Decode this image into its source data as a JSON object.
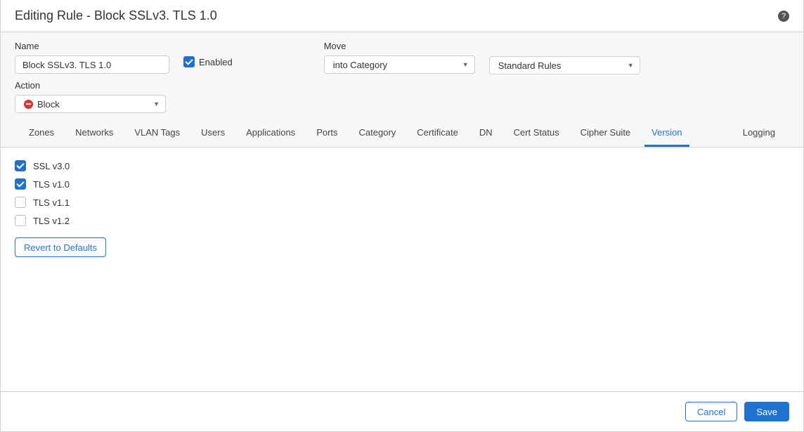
{
  "header": {
    "title": "Editing Rule - Block SSLv3. TLS 1.0"
  },
  "form": {
    "name_label": "Name",
    "name_value": "Block SSLv3. TLS 1.0",
    "enabled_label": "Enabled",
    "enabled_checked": true,
    "move_label": "Move",
    "move_value": "into Category",
    "category_value": "Standard Rules",
    "action_label": "Action",
    "action_value": "Block"
  },
  "tabs": [
    {
      "label": "Zones",
      "active": false
    },
    {
      "label": "Networks",
      "active": false
    },
    {
      "label": "VLAN Tags",
      "active": false
    },
    {
      "label": "Users",
      "active": false
    },
    {
      "label": "Applications",
      "active": false
    },
    {
      "label": "Ports",
      "active": false
    },
    {
      "label": "Category",
      "active": false
    },
    {
      "label": "Certificate",
      "active": false
    },
    {
      "label": "DN",
      "active": false
    },
    {
      "label": "Cert Status",
      "active": false
    },
    {
      "label": "Cipher Suite",
      "active": false
    },
    {
      "label": "Version",
      "active": true
    },
    {
      "label": "Logging",
      "active": false,
      "logging": true
    }
  ],
  "versions": [
    {
      "label": "SSL v3.0",
      "checked": true
    },
    {
      "label": "TLS v1.0",
      "checked": true
    },
    {
      "label": "TLS v1.1",
      "checked": false
    },
    {
      "label": "TLS v1.2",
      "checked": false
    }
  ],
  "buttons": {
    "revert": "Revert to Defaults",
    "cancel": "Cancel",
    "save": "Save"
  }
}
